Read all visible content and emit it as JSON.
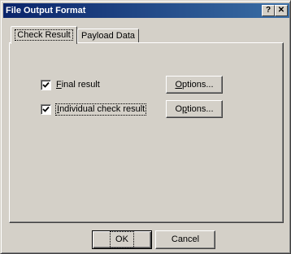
{
  "window": {
    "title": "File Output Format",
    "help_glyph": "?",
    "close_glyph": "✕"
  },
  "tabs": [
    {
      "label": "Check Result",
      "active": true
    },
    {
      "label": "Payload Data",
      "active": false
    }
  ],
  "options": [
    {
      "mnemonic": "F",
      "label_rest": "inal result",
      "checked": true,
      "button_mnemonic": "O",
      "button_rest": "ptions..."
    },
    {
      "mnemonic": "I",
      "label_rest": "ndividual check result",
      "checked": true,
      "button_mnemonic": "p",
      "button_prefix": "O",
      "button_rest": "tions..."
    }
  ],
  "footer": {
    "ok_label": "OK",
    "cancel_label": "Cancel"
  }
}
